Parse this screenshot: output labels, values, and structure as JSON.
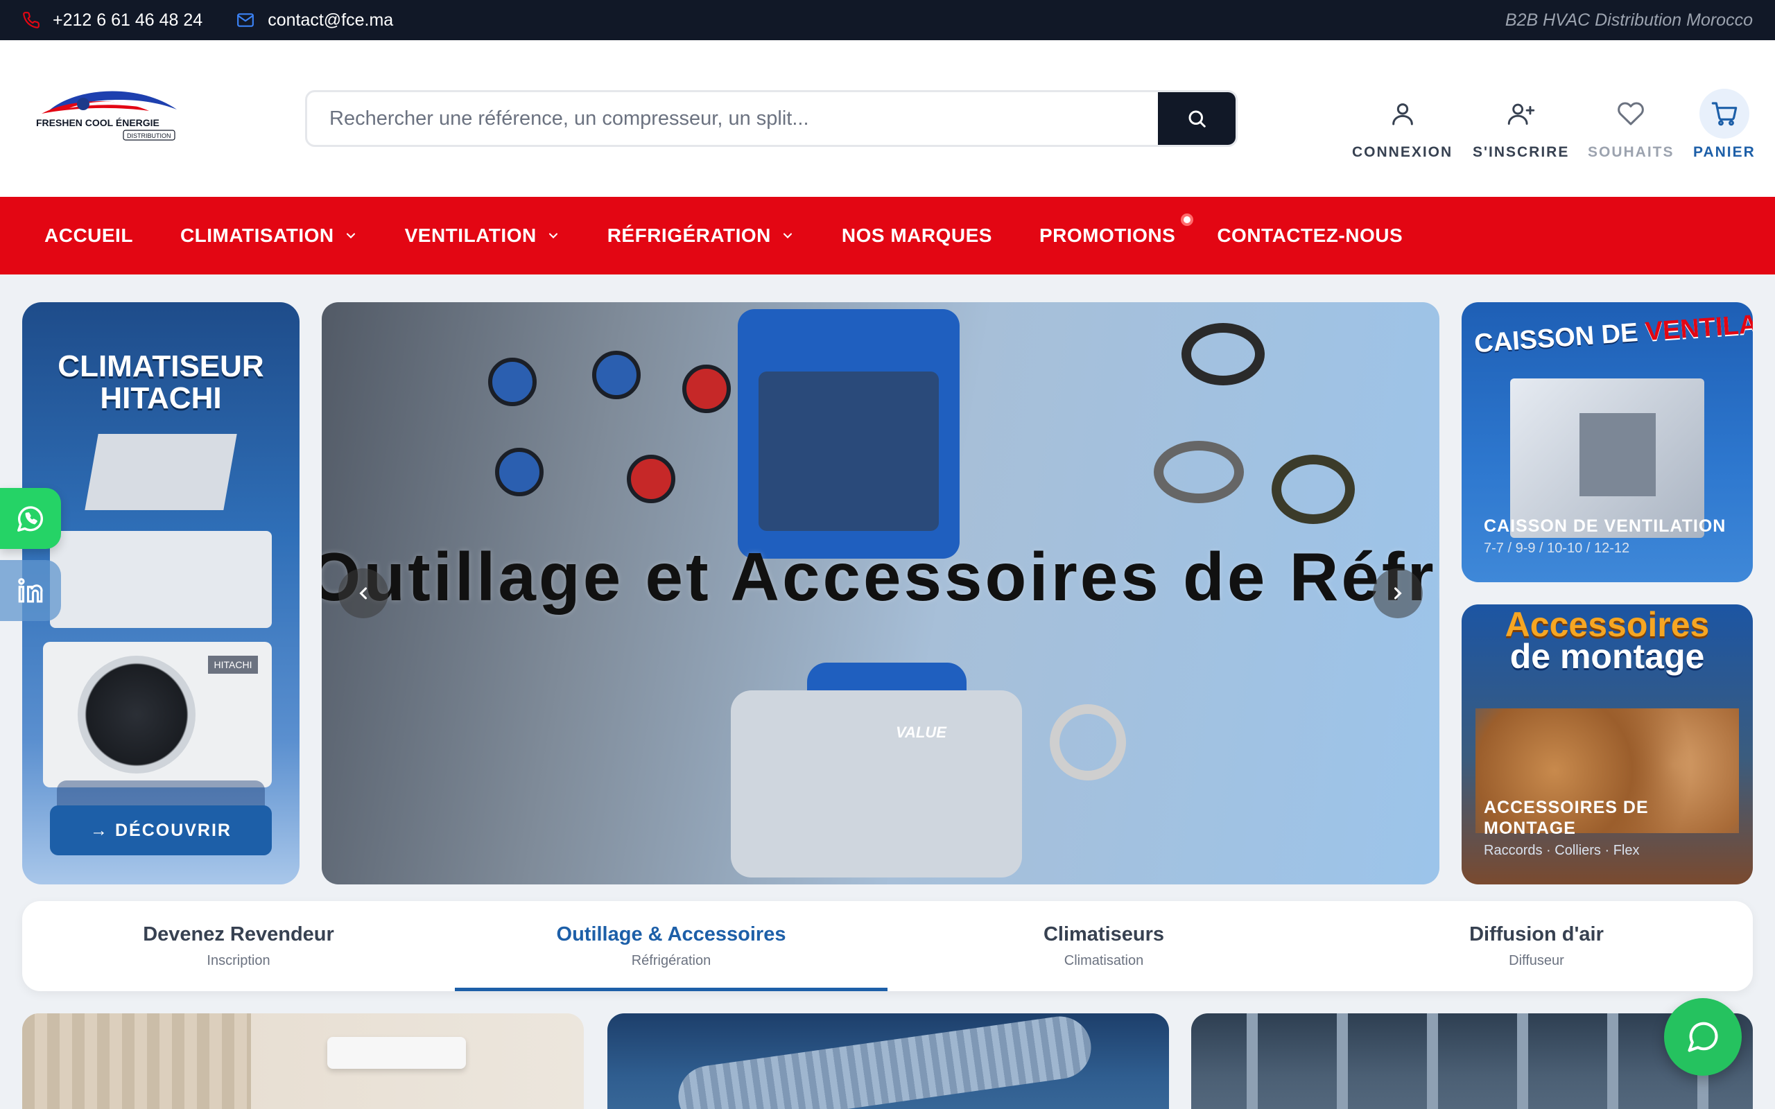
{
  "topbar": {
    "phone": "+212 6 61 46 48 24",
    "email": "contact@fce.ma",
    "tagline": "B2B HVAC Distribution Morocco"
  },
  "header": {
    "logo_text": "FRESHEN COOL ÉNERGIE",
    "logo_subtext": "DISTRIBUTION",
    "search_placeholder": "Rechercher une référence, un compresseur, un split...",
    "actions": {
      "login": "CONNEXION",
      "signup": "S'INSCRIRE",
      "wishlist": "SOUHAITS",
      "cart": "PANIER"
    }
  },
  "nav": {
    "items": [
      {
        "label": "ACCUEIL"
      },
      {
        "label": "CLIMATISATION"
      },
      {
        "label": "VENTILATION"
      },
      {
        "label": "RÉFRIGÉRATION"
      },
      {
        "label": "NOS MARQUES"
      },
      {
        "label": "PROMOTIONS"
      },
      {
        "label": "CONTACTEZ-NOUS"
      }
    ]
  },
  "banner_left": {
    "title_line1": "CLIMATISEUR",
    "title_line2": "HITACHI",
    "brand_plate": "HITACHI",
    "cta": "→ DÉCOUVRIR"
  },
  "slider": {
    "title": "Outillage et Accessoires de Réfrigération",
    "pump_brand": "VALUE"
  },
  "banner_right_top": {
    "headline_word1": "CAISSON DE",
    "headline_word2": "VENTILATION",
    "title": "CAISSON DE VENTILATION",
    "subtitle": "7-7 / 9-9 / 10-10 / 12-12"
  },
  "banner_right_bottom": {
    "headline_line1": "Accessoires",
    "headline_line2": "de montage",
    "title": "ACCESSOIRES DE MONTAGE",
    "subtitle": "Raccords · Colliers · Flex"
  },
  "tabs": [
    {
      "title": "Devenez Revendeur",
      "subtitle": "Inscription",
      "active": false
    },
    {
      "title": "Outillage & Accessoires",
      "subtitle": "Réfrigération",
      "active": true
    },
    {
      "title": "Climatiseurs",
      "subtitle": "Climatisation",
      "active": false
    },
    {
      "title": "Diffusion d'air",
      "subtitle": "Diffuseur",
      "active": false
    }
  ],
  "colors": {
    "brand_red": "#e30613",
    "dark": "#111827",
    "accent_blue": "#1d5fa8",
    "whatsapp_green": "#25d366"
  },
  "icons": {
    "phone": "phone-icon",
    "email": "mail-icon",
    "search": "search-icon",
    "login": "user-icon",
    "signup": "user-plus-icon",
    "wishlist": "heart-icon",
    "cart": "cart-icon",
    "whatsapp": "whatsapp-icon",
    "linkedin": "linkedin-icon",
    "chat": "chat-bubble-icon"
  }
}
